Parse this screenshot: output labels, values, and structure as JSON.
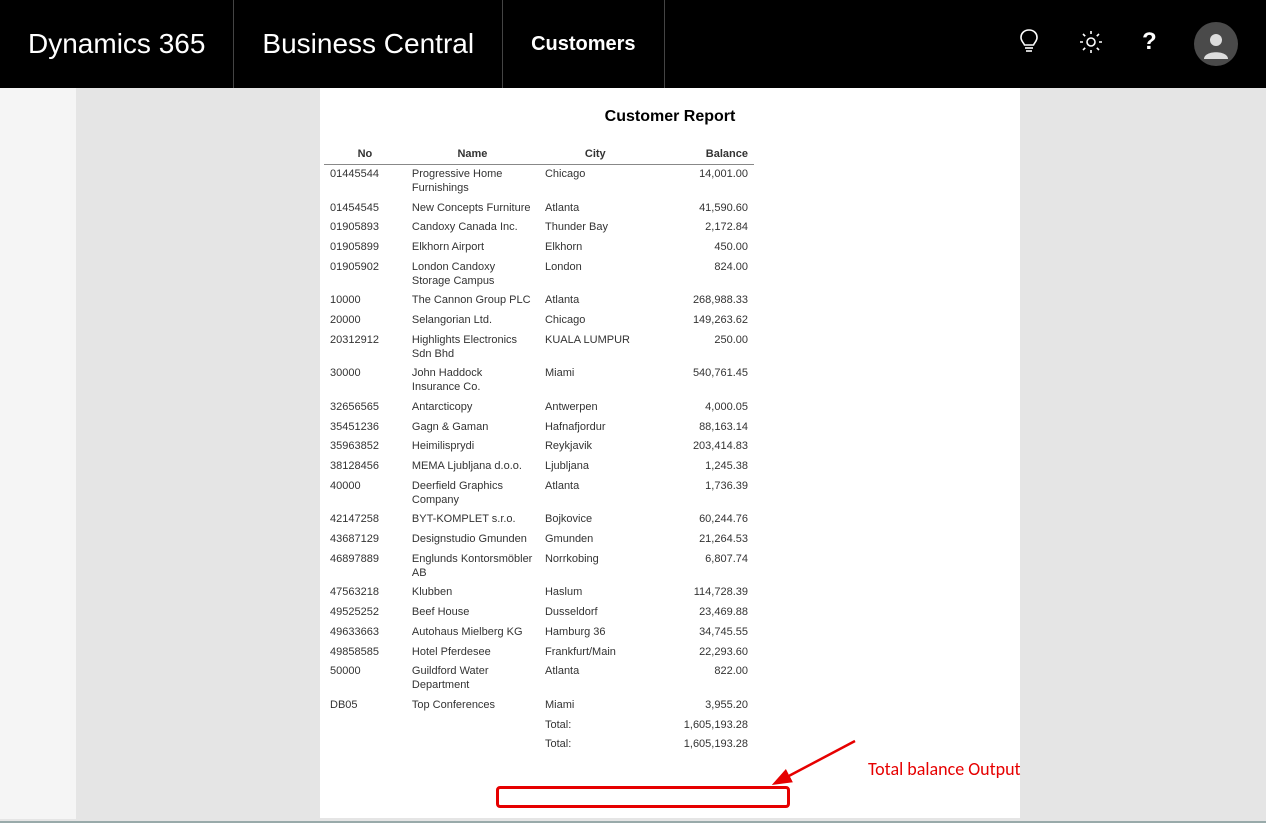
{
  "header": {
    "brand": "Dynamics 365",
    "app": "Business Central",
    "page": "Customers"
  },
  "report": {
    "title": "Customer Report",
    "columns": {
      "no": "No",
      "name": "Name",
      "city": "City",
      "balance": "Balance"
    },
    "rows": [
      {
        "no": "01445544",
        "name": "Progressive Home Furnishings",
        "city": "Chicago",
        "balance": "14,001.00"
      },
      {
        "no": "01454545",
        "name": "New Concepts Furniture",
        "city": "Atlanta",
        "balance": "41,590.60"
      },
      {
        "no": "01905893",
        "name": "Candoxy Canada Inc.",
        "city": "Thunder Bay",
        "balance": "2,172.84"
      },
      {
        "no": "01905899",
        "name": "Elkhorn Airport",
        "city": "Elkhorn",
        "balance": "450.00"
      },
      {
        "no": "01905902",
        "name": "London Candoxy Storage Campus",
        "city": "London",
        "balance": "824.00"
      },
      {
        "no": "10000",
        "name": "The Cannon Group PLC",
        "city": "Atlanta",
        "balance": "268,988.33"
      },
      {
        "no": "20000",
        "name": "Selangorian Ltd.",
        "city": "Chicago",
        "balance": "149,263.62"
      },
      {
        "no": "20312912",
        "name": "Highlights Electronics Sdn Bhd",
        "city": "KUALA LUMPUR",
        "balance": "250.00"
      },
      {
        "no": "30000",
        "name": "John Haddock Insurance Co.",
        "city": "Miami",
        "balance": "540,761.45"
      },
      {
        "no": "32656565",
        "name": "Antarcticopy",
        "city": "Antwerpen",
        "balance": "4,000.05"
      },
      {
        "no": "35451236",
        "name": "Gagn & Gaman",
        "city": "Hafnafjordur",
        "balance": "88,163.14"
      },
      {
        "no": "35963852",
        "name": "Heimilisprydi",
        "city": "Reykjavik",
        "balance": "203,414.83"
      },
      {
        "no": "38128456",
        "name": "MEMA Ljubljana d.o.o.",
        "city": "Ljubljana",
        "balance": "1,245.38"
      },
      {
        "no": "40000",
        "name": "Deerfield Graphics Company",
        "city": "Atlanta",
        "balance": "1,736.39"
      },
      {
        "no": "42147258",
        "name": "BYT-KOMPLET s.r.o.",
        "city": "Bojkovice",
        "balance": "60,244.76"
      },
      {
        "no": "43687129",
        "name": "Designstudio Gmunden",
        "city": "Gmunden",
        "balance": "21,264.53"
      },
      {
        "no": "46897889",
        "name": "Englunds Kontorsmöbler AB",
        "city": "Norrkobing",
        "balance": "6,807.74"
      },
      {
        "no": "47563218",
        "name": "Klubben",
        "city": "Haslum",
        "balance": "114,728.39"
      },
      {
        "no": "49525252",
        "name": "Beef House",
        "city": "Dusseldorf",
        "balance": "23,469.88"
      },
      {
        "no": "49633663",
        "name": "Autohaus Mielberg KG",
        "city": "Hamburg 36",
        "balance": "34,745.55"
      },
      {
        "no": "49858585",
        "name": "Hotel Pferdesee",
        "city": "Frankfurt/Main",
        "balance": "22,293.60"
      },
      {
        "no": "50000",
        "name": "Guildford Water Department",
        "city": "Atlanta",
        "balance": "822.00"
      },
      {
        "no": "DB05",
        "name": "Top Conferences",
        "city": "Miami",
        "balance": "3,955.20"
      }
    ],
    "totals": [
      {
        "label": "Total:",
        "value": "1,605,193.28"
      },
      {
        "label": "Total:",
        "value": "1,605,193.28"
      }
    ]
  },
  "annotation": {
    "label": "Total balance Output"
  }
}
